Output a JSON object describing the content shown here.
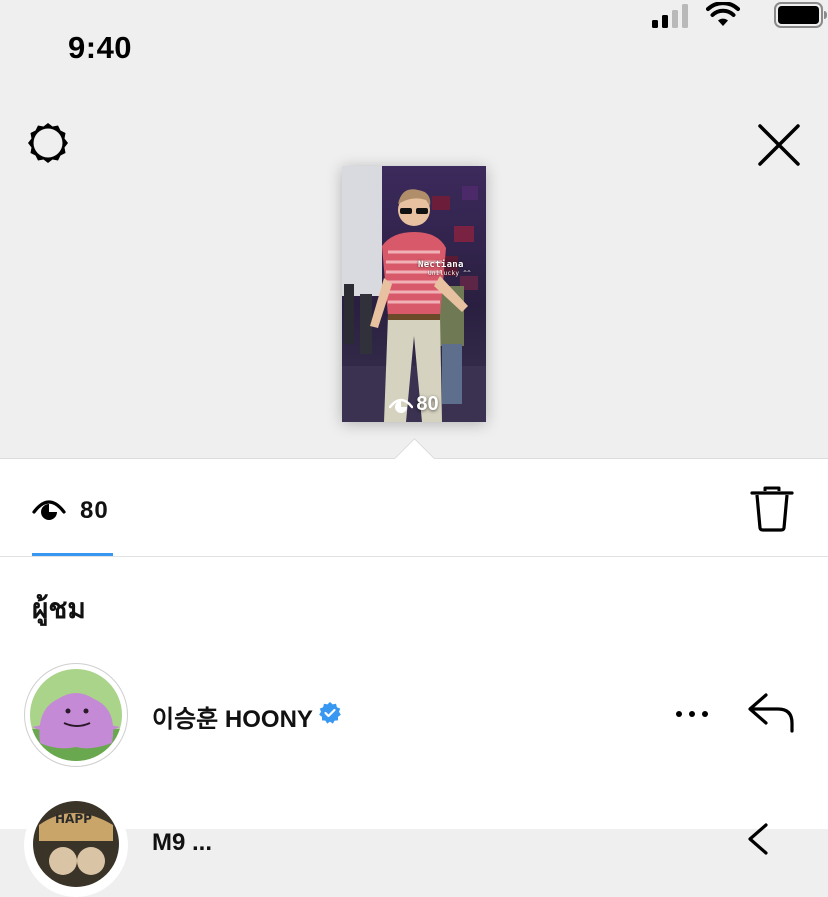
{
  "status_bar": {
    "time": "9:40"
  },
  "story": {
    "views_overlay": "80",
    "sticker_text": "Nectiana",
    "sticker_subtext": "Unilucky ^^"
  },
  "stats": {
    "views": "80"
  },
  "viewers": {
    "section_title": "ผู้ชม",
    "items": [
      {
        "name": "이승훈 HOONY",
        "verified": true
      },
      {
        "name": "M9 ..."
      }
    ]
  },
  "colors": {
    "accent": "#3897f0",
    "verified": "#3897f0"
  }
}
